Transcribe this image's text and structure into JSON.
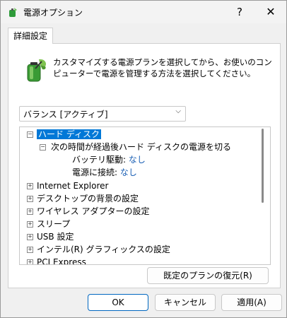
{
  "window": {
    "title": "電源オプション",
    "help_glyph": "?",
    "close_glyph": "✕"
  },
  "tab": {
    "label": "詳細設定"
  },
  "description": "カスタマイズする電源プランを選択してから、お使いのコンピューターで電源を管理する方法を選択してください。",
  "plan_select": {
    "value": "バランス [アクティブ]"
  },
  "tree": {
    "hard_disk": {
      "label": "ハード ディスク"
    },
    "turn_off_disk": {
      "label": "次の時間が経過後ハード ディスクの電源を切る"
    },
    "battery_row": {
      "label": "バッテリ駆動:",
      "value": "なし"
    },
    "plugged_row": {
      "label": "電源に接続:",
      "value": "なし"
    },
    "items": [
      "Internet Explorer",
      "デスクトップの背景の設定",
      "ワイヤレス アダプターの設定",
      "スリープ",
      "USB 設定",
      "インテル(R) グラフィックスの設定",
      "PCI Express"
    ]
  },
  "buttons": {
    "restore": "既定のプランの復元(R)",
    "ok": "OK",
    "cancel": "キャンセル",
    "apply": "適用(A)"
  },
  "colors": {
    "selection": "#0078d7",
    "value_link": "#1a5fb4",
    "accent": "#0067c0"
  }
}
